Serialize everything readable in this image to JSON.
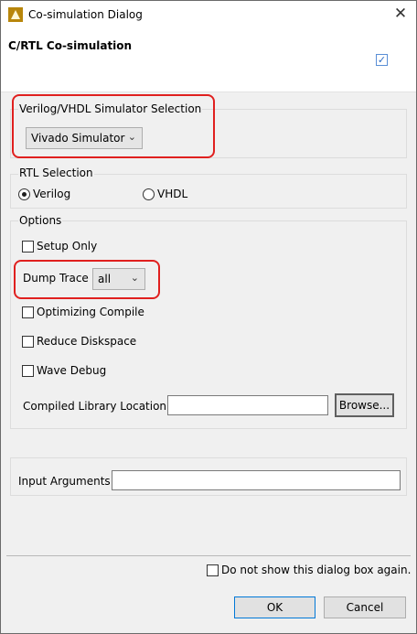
{
  "window": {
    "title": "Co-simulation Dialog",
    "close_glyph": "✕"
  },
  "header": {
    "title": "C/RTL Co-simulation",
    "check_glyph": "✓"
  },
  "simulator": {
    "group_label": "Verilog/VHDL Simulator Selection",
    "selected": "Vivado Simulator"
  },
  "rtl": {
    "group_label": "RTL Selection",
    "options": [
      {
        "label": "Verilog",
        "selected": true
      },
      {
        "label": "VHDL",
        "selected": false
      }
    ]
  },
  "options": {
    "group_label": "Options",
    "setup_only": "Setup Only",
    "dump_trace_label": "Dump Trace",
    "dump_trace_value": "all",
    "optimizing_compile": "Optimizing Compile",
    "reduce_diskspace": "Reduce Diskspace",
    "wave_debug": "Wave Debug",
    "compiled_library_label": "Compiled Library Location",
    "compiled_library_value": "",
    "browse_label": "Browse..."
  },
  "input_arguments": {
    "label": "Input Arguments",
    "value": ""
  },
  "footer": {
    "dont_show_label": "Do not show this dialog box again.",
    "ok_label": "OK",
    "cancel_label": "Cancel"
  },
  "icons": {
    "title_icon": "vivado-hls-logo-icon",
    "combo_arrow": "chevron-down-icon"
  },
  "colors": {
    "highlight": "#e0201f",
    "focus": "#0078d7",
    "check": "#2b6cc4"
  }
}
